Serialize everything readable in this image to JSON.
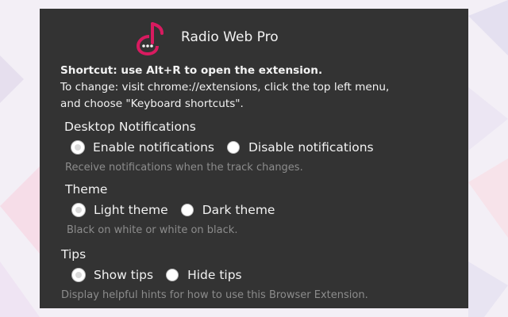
{
  "app": {
    "title": "Radio Web Pro",
    "logo_icon": "music-note-chat-icon",
    "logo_color": "#d81b60"
  },
  "info": {
    "shortcut": "Shortcut: use Alt+R to open the extension.",
    "change_line1": "To change: visit chrome://extensions, click the top left menu,",
    "change_line2": "and choose \"Keyboard shortcuts\"."
  },
  "notifications": {
    "title": "Desktop Notifications",
    "options": [
      {
        "label": "Enable notifications",
        "checked": true
      },
      {
        "label": "Disable notifications",
        "checked": false
      }
    ],
    "description": "Receive notifications when the track changes."
  },
  "theme": {
    "title": "Theme",
    "options": [
      {
        "label": "Light theme",
        "checked": true
      },
      {
        "label": "Dark theme",
        "checked": false
      }
    ],
    "description": "Black on white or white on black."
  },
  "tips": {
    "title": "Tips",
    "options": [
      {
        "label": "Show tips",
        "checked": true
      },
      {
        "label": "Hide tips",
        "checked": false
      }
    ],
    "description": "Display helpful hints for how to use this Browser Extension."
  },
  "colors": {
    "panel": "#333333",
    "background": "#f3eff6"
  }
}
